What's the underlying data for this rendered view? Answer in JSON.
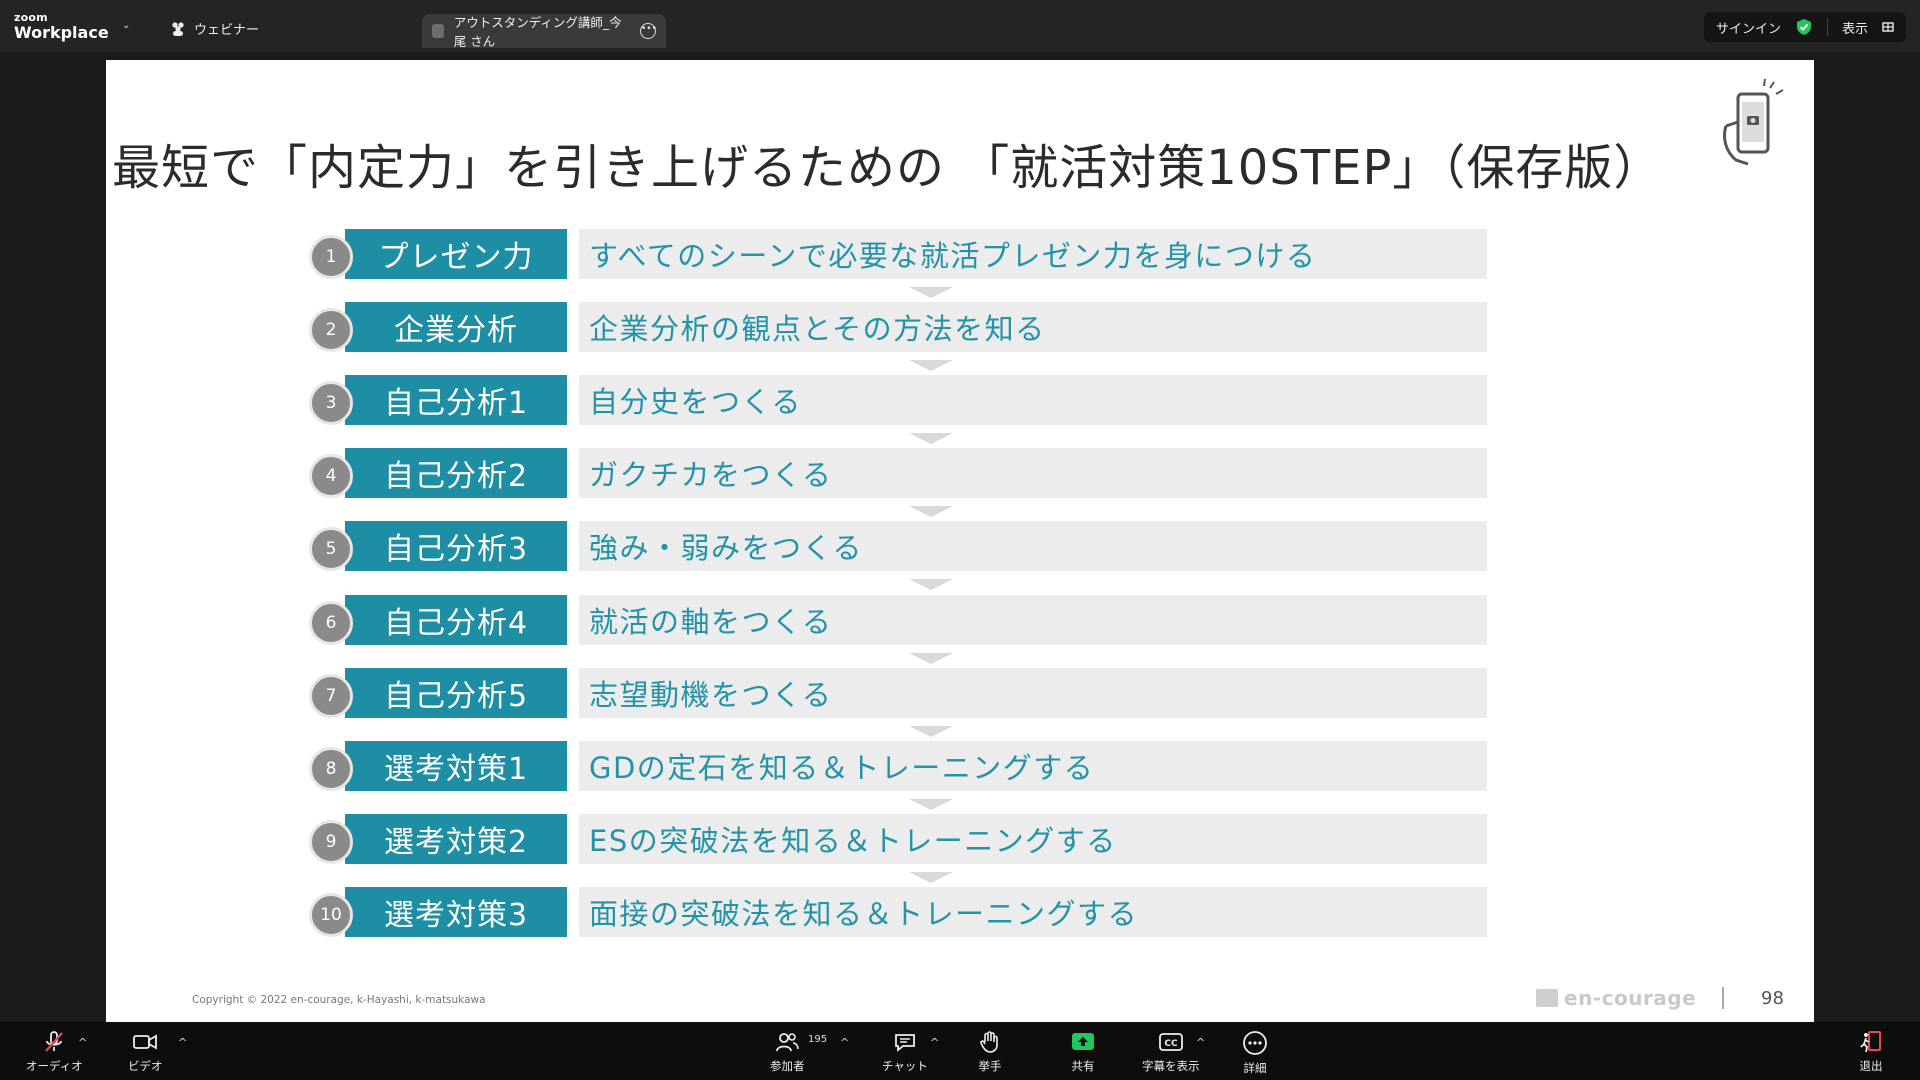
{
  "topbar": {
    "logo_small": "zoom",
    "logo_large": "Workplace",
    "webinar_label": "ウェビナー",
    "tab_title": "アウトスタンディング講師_今尾 さん",
    "signin_label": "サインイン",
    "view_label": "表示"
  },
  "slide": {
    "title": "最短で「内定力」を引き上げるための 「就活対策10STEP」（保存版）",
    "steps": [
      {
        "num": "1",
        "label": "プレゼン力",
        "desc": "すべてのシーンで必要な就活プレゼン力を身につける"
      },
      {
        "num": "2",
        "label": "企業分析",
        "desc": "企業分析の観点とその方法を知る"
      },
      {
        "num": "3",
        "label": "自己分析1",
        "desc": "自分史をつくる"
      },
      {
        "num": "4",
        "label": "自己分析2",
        "desc": "ガクチカをつくる"
      },
      {
        "num": "5",
        "label": "自己分析3",
        "desc": "強み・弱みをつくる"
      },
      {
        "num": "6",
        "label": "自己分析4",
        "desc": "就活の軸をつくる"
      },
      {
        "num": "7",
        "label": "自己分析5",
        "desc": "志望動機をつくる"
      },
      {
        "num": "8",
        "label": "選考対策1",
        "desc": "GDの定石を知る＆トレーニングする"
      },
      {
        "num": "9",
        "label": "選考対策2",
        "desc": "ESの突破法を知る＆トレーニングする"
      },
      {
        "num": "10",
        "label": "選考対策3",
        "desc": "面接の突破法を知る＆トレーニングする"
      }
    ],
    "copyright": "Copyright © 2022 en-courage, k-Hayashi, k-matsukawa",
    "brand": "en-courage",
    "page_number": "98",
    "colors": {
      "label_bg": "#1e8ea4",
      "desc_text": "#2493a8",
      "desc_bg": "#ececec",
      "num_bg": "#8a8a8a"
    }
  },
  "toolbar": {
    "audio_label": "オーディオ",
    "video_label": "ビデオ",
    "participants_label": "参加者",
    "participants_count": "195",
    "chat_label": "チャット",
    "raise_hand_label": "挙手",
    "share_label": "共有",
    "captions_label": "字幕を表示",
    "more_label": "詳細",
    "leave_label": "退出",
    "share_color": "#22c55e",
    "leave_color": "#e5484d"
  }
}
